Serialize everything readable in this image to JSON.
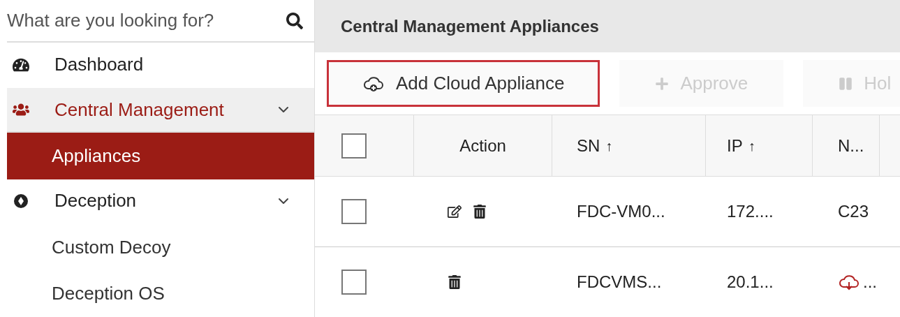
{
  "search": {
    "placeholder": "What are you looking for?"
  },
  "nav": [
    {
      "label": "Dashboard",
      "kind": "dashboard",
      "selected": false
    },
    {
      "label": "Central Management",
      "kind": "people",
      "selected": true,
      "expanded": true,
      "children": [
        {
          "label": "Appliances",
          "selected": true
        }
      ]
    },
    {
      "label": "Deception",
      "kind": "decoy",
      "selected": false,
      "expanded": true,
      "children": [
        {
          "label": "Custom Decoy",
          "selected": false
        },
        {
          "label": "Deception OS",
          "selected": false
        }
      ]
    }
  ],
  "page": {
    "title": "Central Management Appliances"
  },
  "toolbar": [
    {
      "label": "Add Cloud Appliance",
      "kind": "cloud-plus",
      "highlighted": true,
      "disabled": false
    },
    {
      "label": "Approve",
      "kind": "plus",
      "highlighted": false,
      "disabled": true
    },
    {
      "label": "Hol",
      "kind": "pause",
      "highlighted": false,
      "disabled": true
    }
  ],
  "table": {
    "select_all": {
      "checked": false
    },
    "columns": [
      {
        "label": "Action"
      },
      {
        "label": "SN",
        "sort_mark": "↑"
      },
      {
        "label": "IP",
        "sort_mark": "↑"
      },
      {
        "label": "N..."
      }
    ],
    "rows": [
      {
        "checked": false,
        "actions": [
          {
            "kind": "edit"
          },
          {
            "kind": "delete"
          }
        ],
        "sn": "FDC-VM0...",
        "ip": "172....",
        "column_5": {
          "text": "C23"
        }
      },
      {
        "checked": false,
        "actions": [
          {
            "kind": "delete"
          }
        ],
        "sn": "FDCVMS...",
        "ip": "20.1...",
        "column_5": {
          "kind": "cloud-alert",
          "text": "..."
        }
      }
    ]
  }
}
